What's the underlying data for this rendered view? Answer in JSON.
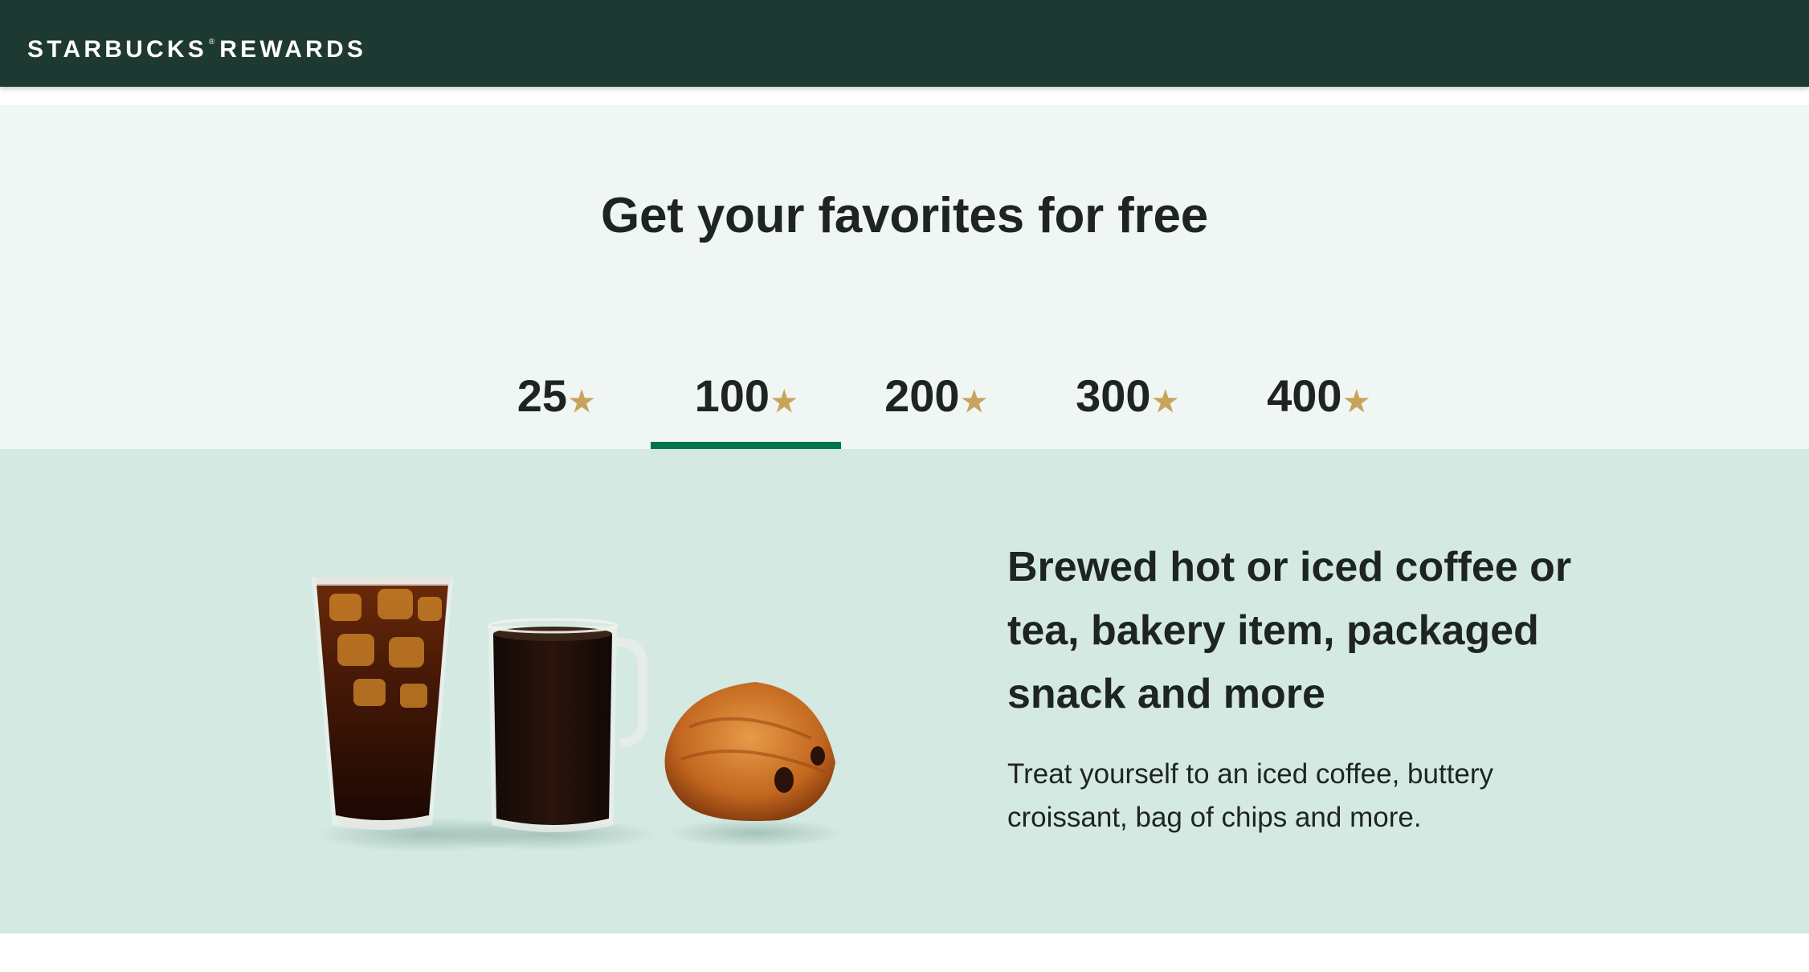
{
  "header": {
    "brand_name": "STARBUCKS",
    "brand_registered": "®",
    "brand_suffix": "REWARDS",
    "background_color": "#1e3932"
  },
  "tiers": {
    "title": "Get your favorites for free",
    "star_color": "#c8a45b",
    "active_color": "#00754a",
    "selected": "100",
    "items": [
      {
        "value": "25",
        "star": "★",
        "selected": false
      },
      {
        "value": "100",
        "star": "★",
        "selected": true
      },
      {
        "value": "200",
        "star": "★",
        "selected": false
      },
      {
        "value": "300",
        "star": "★",
        "selected": false
      },
      {
        "value": "400",
        "star": "★",
        "selected": false
      }
    ]
  },
  "reward": {
    "title": "Brewed hot or iced coffee or tea, bakery item, packaged snack and more",
    "description": "Treat yourself to an iced coffee, buttery croissant, bag of chips and more.",
    "image_items": [
      "iced-coffee-glass-icon",
      "hot-coffee-mug-icon",
      "chocolate-croissant-icon"
    ],
    "background_color": "#d4e9e2"
  }
}
